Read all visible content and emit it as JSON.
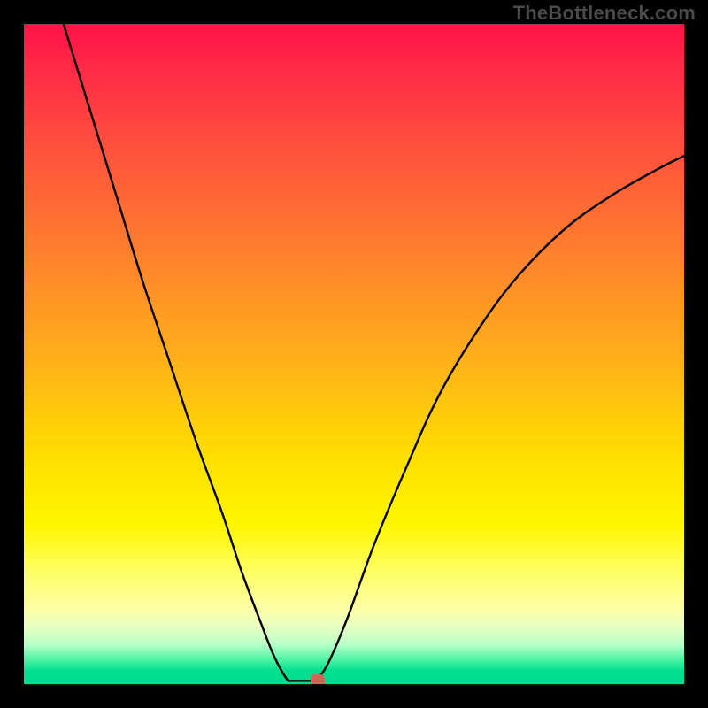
{
  "watermark": "TheBottleneck.com",
  "chart_data": {
    "type": "line",
    "title": "",
    "xlabel": "",
    "ylabel": "",
    "xlim": [
      0,
      100
    ],
    "ylim": [
      0,
      100
    ],
    "grid": false,
    "legend": false,
    "gradient_stops": [
      {
        "pos": 0,
        "color": "#ff1248"
      },
      {
        "pos": 8,
        "color": "#ff2e46"
      },
      {
        "pos": 22,
        "color": "#ff5a3a"
      },
      {
        "pos": 38,
        "color": "#ff8a2a"
      },
      {
        "pos": 52,
        "color": "#ffb418"
      },
      {
        "pos": 66,
        "color": "#ffe000"
      },
      {
        "pos": 76,
        "color": "#fff600"
      },
      {
        "pos": 83,
        "color": "#ffff66"
      },
      {
        "pos": 88,
        "color": "#feff9e"
      },
      {
        "pos": 91,
        "color": "#ecffc0"
      },
      {
        "pos": 94,
        "color": "#b8ffc8"
      },
      {
        "pos": 96,
        "color": "#5cf5a8"
      },
      {
        "pos": 98,
        "color": "#00e090"
      },
      {
        "pos": 100,
        "color": "#00db90"
      }
    ],
    "series": [
      {
        "name": "left-branch",
        "x": [
          6,
          10,
          14,
          18,
          22,
          26,
          30,
          33,
          36,
          38,
          39.8,
          40.5
        ],
        "y": [
          100,
          87,
          74,
          61,
          49,
          37,
          26,
          17,
          9,
          4,
          0.8,
          0.5
        ]
      },
      {
        "name": "valley-floor",
        "x": [
          40.5,
          44.2
        ],
        "y": [
          0.5,
          0.5
        ]
      },
      {
        "name": "right-branch",
        "x": [
          44.2,
          46,
          49,
          53,
          58,
          63,
          69,
          75,
          82,
          89,
          96,
          100
        ],
        "y": [
          0.5,
          3,
          10,
          21,
          33,
          44,
          54,
          62,
          69,
          74,
          78,
          80
        ]
      }
    ],
    "marker": {
      "x": 44.5,
      "y": 0.5,
      "color": "#cc6a55"
    }
  }
}
